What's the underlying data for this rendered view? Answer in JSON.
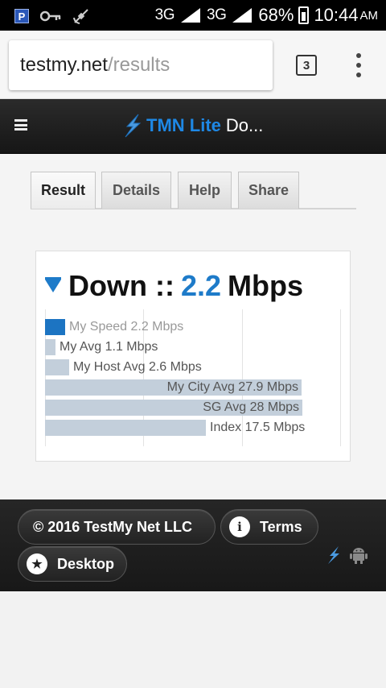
{
  "status_bar": {
    "network": "3G",
    "battery_percent": "68%",
    "time": "10:44",
    "ampm": "AM",
    "icons": [
      "parking-icon",
      "key-icon",
      "satellite-icon",
      "signal-icon",
      "battery-icon"
    ]
  },
  "browser": {
    "url_host": "testmy.net",
    "url_path": "/results",
    "tab_count": "3"
  },
  "header": {
    "brand": "TMN Lite",
    "title": "Do..."
  },
  "tabs": [
    {
      "label": "Result",
      "active": true
    },
    {
      "label": "Details",
      "active": false
    },
    {
      "label": "Help",
      "active": false
    },
    {
      "label": "Share",
      "active": false
    }
  ],
  "result": {
    "direction": "Down",
    "separator": "::",
    "value": "2.2",
    "unit": "Mbps"
  },
  "chart_data": {
    "type": "bar",
    "orientation": "horizontal",
    "categories": [
      "My Speed",
      "My Avg",
      "My Host Avg",
      "My City Avg",
      "SG Avg",
      "Index"
    ],
    "values": [
      2.2,
      1.1,
      2.6,
      27.9,
      28,
      17.5
    ],
    "labels": [
      "My Speed 2.2 Mbps",
      "My Avg 1.1 Mbps",
      "My Host Avg 2.6 Mbps",
      "My City Avg 27.9 Mbps",
      "SG Avg 28 Mbps",
      "Index 17.5 Mbps"
    ],
    "unit": "Mbps",
    "xlim": [
      0,
      30
    ],
    "highlight": "My Speed",
    "colors": {
      "highlight": "#1c74c2",
      "bar": "#c3cfdb"
    },
    "grid": true
  },
  "footer": {
    "copyright": "© 2016 TestMy Net LLC",
    "terms": "Terms",
    "desktop": "Desktop"
  },
  "colors": {
    "accent": "#1e7bc9",
    "header_bg": "#1c1c1c"
  }
}
